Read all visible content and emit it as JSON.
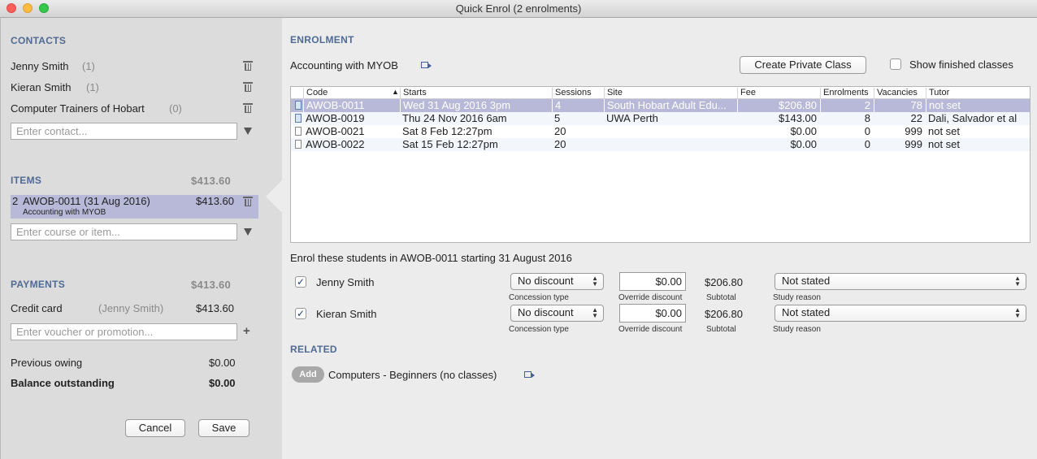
{
  "window": {
    "title": "Quick Enrol (2 enrolments)"
  },
  "contacts": {
    "heading": "CONTACTS",
    "items": [
      {
        "name": "Jenny Smith",
        "count": "(1)"
      },
      {
        "name": "Kieran Smith",
        "count": "(1)"
      },
      {
        "name": "Computer Trainers of Hobart",
        "count": "(0)"
      }
    ],
    "input_placeholder": "Enter contact..."
  },
  "items": {
    "heading": "ITEMS",
    "total": "$413.60",
    "row": {
      "qty": "2",
      "code": "AWOB-0011 (31 Aug 2016)",
      "amount": "$413.60",
      "subtitle": "Accounting with MYOB"
    },
    "input_placeholder": "Enter course or item..."
  },
  "payments": {
    "heading": "PAYMENTS",
    "total": "$413.60",
    "method": "Credit card",
    "payer": "(Jenny Smith)",
    "amount": "$413.60",
    "voucher_placeholder": "Enter voucher or promotion...",
    "previous_owing_label": "Previous owing",
    "previous_owing": "$0.00",
    "balance_label": "Balance outstanding",
    "balance": "$0.00"
  },
  "buttons": {
    "cancel": "Cancel",
    "save": "Save",
    "create_private_class": "Create Private Class",
    "add": "Add"
  },
  "enrolment": {
    "heading": "ENROLMENT",
    "course": "Accounting with MYOB",
    "show_finished_label": "Show finished classes",
    "show_finished_checked": false,
    "table": {
      "columns": [
        "Code",
        "Starts",
        "Sessions",
        "Site",
        "Fee",
        "Enrolments",
        "Vacancies",
        "Tutor"
      ],
      "sort_indicator": "▲",
      "rows": [
        {
          "code": "AWOB-0011",
          "starts": "Wed 31 Aug 2016 3pm",
          "sessions": "4",
          "site": "South Hobart Adult Edu...",
          "fee": "$206.80",
          "enrolments": "2",
          "vacancies": "78",
          "tutor": "not set",
          "selected": true
        },
        {
          "code": "AWOB-0019",
          "starts": "Thu 24 Nov 2016 6am",
          "sessions": "5",
          "site": "UWA Perth",
          "fee": "$143.00",
          "enrolments": "8",
          "vacancies": "22",
          "tutor": "Dali, Salvador et al",
          "selected": false
        },
        {
          "code": "AWOB-0021",
          "starts": "Sat 8 Feb 12:27pm",
          "sessions": "20",
          "site": "",
          "fee": "$0.00",
          "enrolments": "0",
          "vacancies": "999",
          "tutor": "not set",
          "selected": false
        },
        {
          "code": "AWOB-0022",
          "starts": "Sat 15 Feb 12:27pm",
          "sessions": "20",
          "site": "",
          "fee": "$0.00",
          "enrolments": "0",
          "vacancies": "999",
          "tutor": "not set",
          "selected": false
        }
      ]
    },
    "enrol_sentence": "Enrol these students in AWOB-0011 starting 31 August 2016",
    "students": [
      {
        "name": "Jenny Smith",
        "checked": true,
        "concession": "No discount",
        "override": "$0.00",
        "subtotal": "$206.80",
        "study_reason": "Not stated"
      },
      {
        "name": "Kieran Smith",
        "checked": true,
        "concession": "No discount",
        "override": "$0.00",
        "subtotal": "$206.80",
        "study_reason": "Not stated"
      }
    ],
    "captions": {
      "concession": "Concession type",
      "override": "Override discount",
      "subtotal": "Subtotal",
      "study_reason": "Study reason"
    }
  },
  "related": {
    "heading": "RELATED",
    "item": "Computers - Beginners (no classes)"
  }
}
